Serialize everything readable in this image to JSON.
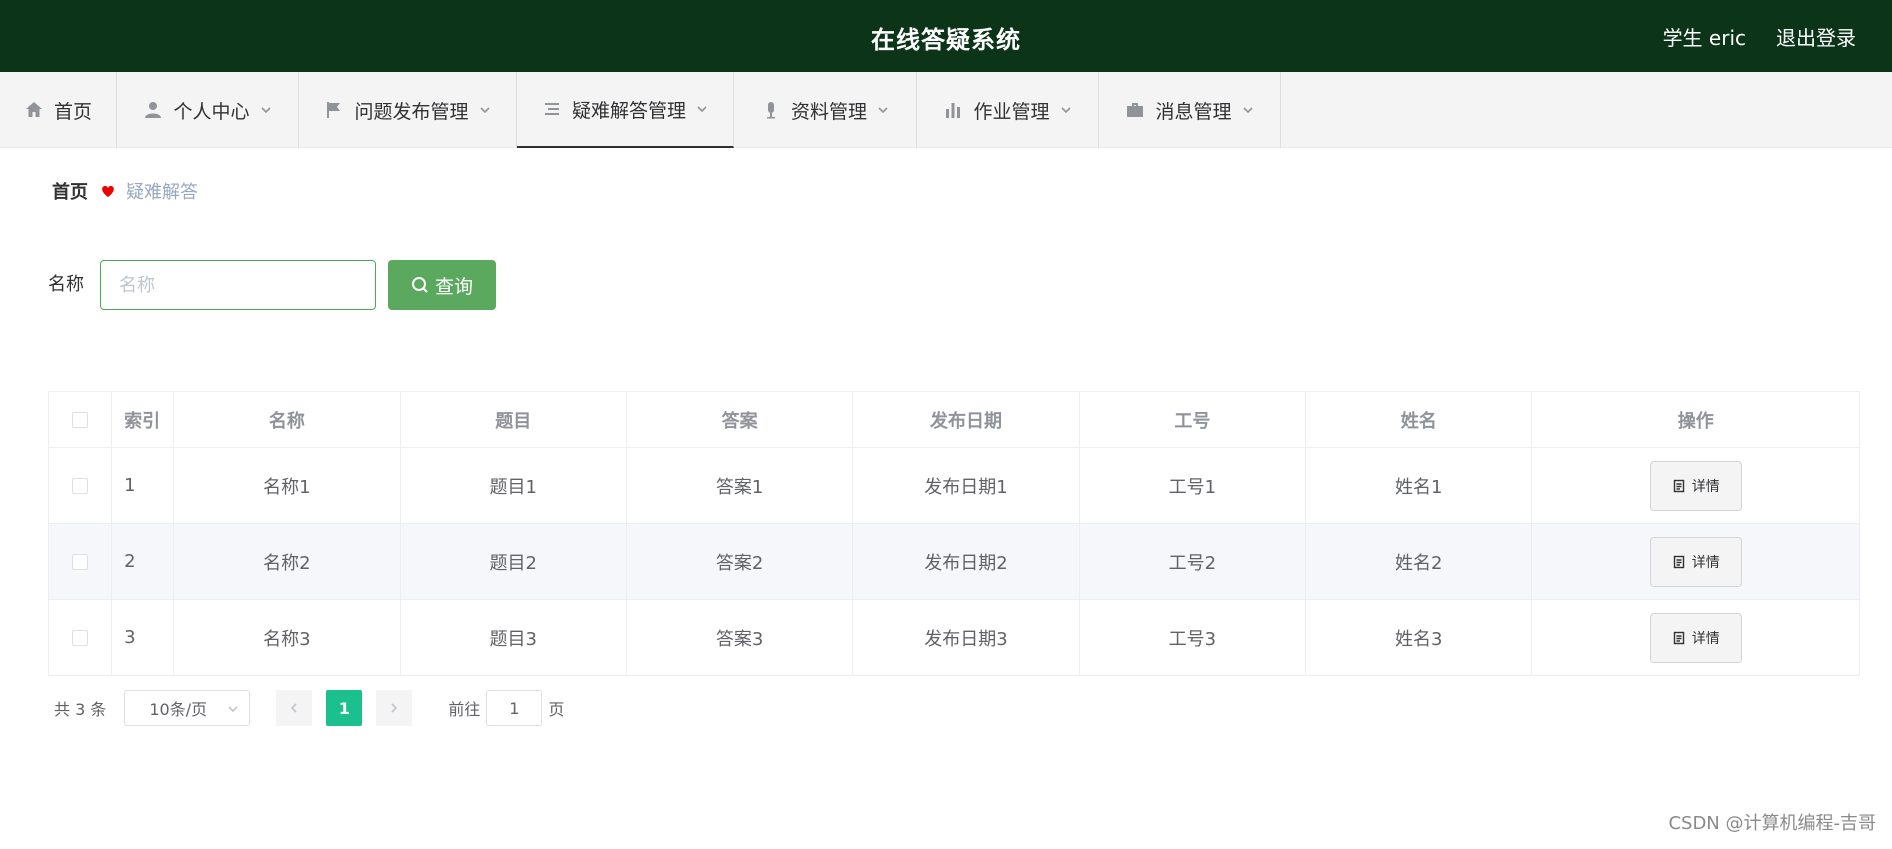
{
  "header": {
    "title": "在线答疑系统",
    "user": "学生 eric",
    "logout": "退出登录"
  },
  "nav": [
    {
      "label": "首页",
      "icon": "home-icon"
    },
    {
      "label": "个人中心",
      "icon": "user-icon"
    },
    {
      "label": "问题发布管理",
      "icon": "flag-icon"
    },
    {
      "label": "疑难解答管理",
      "icon": "list-icon"
    },
    {
      "label": "资料管理",
      "icon": "microphone-icon"
    },
    {
      "label": "作业管理",
      "icon": "bar-chart-icon"
    },
    {
      "label": "消息管理",
      "icon": "briefcase-icon"
    }
  ],
  "breadcrumb": {
    "home": "首页",
    "current": "疑难解答"
  },
  "search": {
    "label": "名称",
    "placeholder": "名称",
    "button": "查询"
  },
  "table": {
    "headers": [
      "索引",
      "名称",
      "题目",
      "答案",
      "发布日期",
      "工号",
      "姓名",
      "操作"
    ],
    "rows": [
      {
        "index": "1",
        "name": "名称1",
        "topic": "题目1",
        "answer": "答案1",
        "date": "发布日期1",
        "job_no": "工号1",
        "person": "姓名1",
        "action": "详情"
      },
      {
        "index": "2",
        "name": "名称2",
        "topic": "题目2",
        "answer": "答案2",
        "date": "发布日期2",
        "job_no": "工号2",
        "person": "姓名2",
        "action": "详情"
      },
      {
        "index": "3",
        "name": "名称3",
        "topic": "题目3",
        "answer": "答案3",
        "date": "发布日期3",
        "job_no": "工号3",
        "person": "姓名3",
        "action": "详情"
      }
    ]
  },
  "pagination": {
    "total": "共 3 条",
    "page_size": "10条/页",
    "current_page": "1",
    "goto_label": "前往",
    "goto_value": "1",
    "goto_unit": "页"
  },
  "watermark": "CSDN @计算机编程-吉哥",
  "colors": {
    "header_bg": "#0b3419",
    "accent": "#5ba85f",
    "page_active": "#1cbf8e",
    "heart": "#f00000"
  }
}
